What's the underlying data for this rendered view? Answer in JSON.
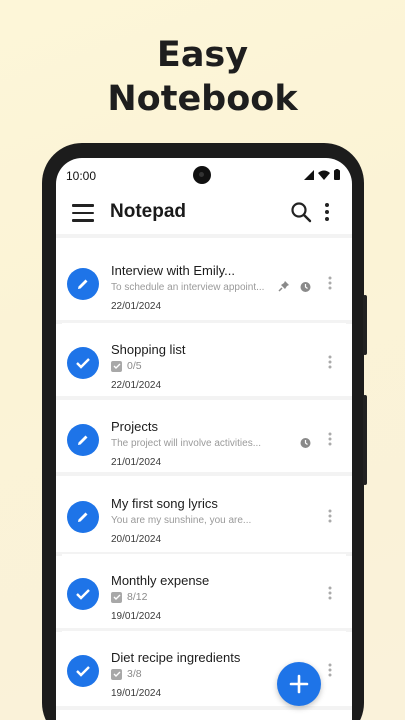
{
  "promo": {
    "line1": "Easy",
    "line2": "Notebook"
  },
  "status_bar": {
    "time": "10:00"
  },
  "app_bar": {
    "title": "Notepad"
  },
  "notes": [
    {
      "title": "Interview with Emily...",
      "preview": "To schedule an interview appoint...",
      "date": "22/01/2024",
      "kind": "note",
      "pinned": true,
      "alarm": true
    },
    {
      "title": "Shopping list",
      "checklist": "0/5",
      "date": "22/01/2024",
      "kind": "checklist"
    },
    {
      "title": "Projects",
      "preview": "The project will involve activities...",
      "date": "21/01/2024",
      "kind": "note",
      "alarm": true
    },
    {
      "title": "My first song lyrics",
      "preview": "You are my sunshine, you are...",
      "date": "20/01/2024",
      "kind": "note"
    },
    {
      "title": "Monthly expense",
      "checklist": "8/12",
      "date": "19/01/2024",
      "kind": "checklist"
    },
    {
      "title": "Diet recipe ingredients",
      "checklist": "3/8",
      "date": "19/01/2024",
      "kind": "checklist"
    }
  ],
  "colors": {
    "accent": "#1e74e8",
    "background": "#fdf6d8"
  },
  "icons": [
    "menu-icon",
    "search-icon",
    "more-vert-icon",
    "pencil-icon",
    "check-icon",
    "pin-icon",
    "alarm-icon",
    "add-icon"
  ]
}
